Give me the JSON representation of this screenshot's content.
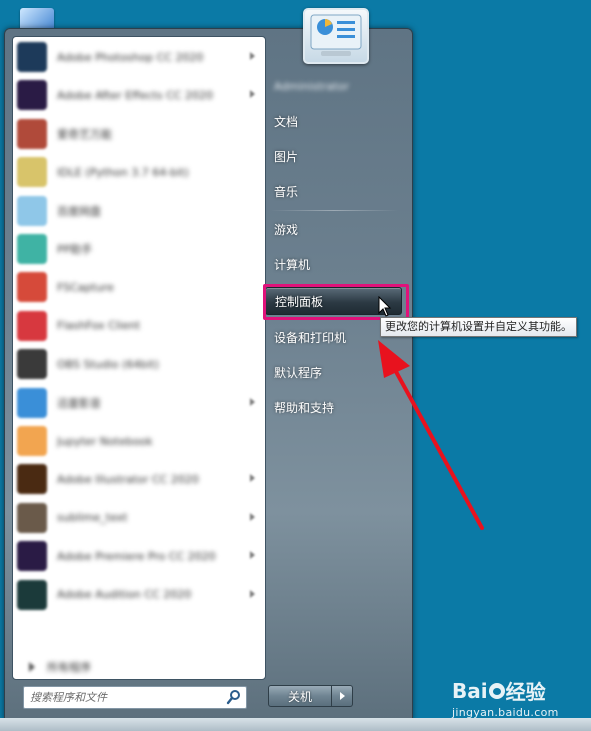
{
  "start_menu": {
    "programs": [
      {
        "label": "Adobe Photoshop CC 2020",
        "color": "#1d3a5a",
        "arrow": true
      },
      {
        "label": "Adobe After Effects CC 2020",
        "color": "#2a1b45",
        "arrow": true
      },
      {
        "label": "爱奇艺万能",
        "color": "#b04a3a",
        "arrow": false
      },
      {
        "label": "IDLE (Python 3.7 64-bit)",
        "color": "#d8c46a",
        "arrow": false
      },
      {
        "label": "百度网盘",
        "color": "#8fc7e8",
        "arrow": false
      },
      {
        "label": "PP助手",
        "color": "#3fb3a4",
        "arrow": false
      },
      {
        "label": "FSCapture",
        "color": "#d64a3a",
        "arrow": false
      },
      {
        "label": "FlashFox Client",
        "color": "#d7383f",
        "arrow": false
      },
      {
        "label": "OBS Studio (64bit)",
        "color": "#3a3a3a",
        "arrow": false
      },
      {
        "label": "迅雷影音",
        "color": "#3a8fd8",
        "arrow": true
      },
      {
        "label": "Jupyter Notebook",
        "color": "#f2a550",
        "arrow": false
      },
      {
        "label": "Adobe Illustrator CC 2020",
        "color": "#4a2a12",
        "arrow": true
      },
      {
        "label": "sublime_text",
        "color": "#6a5a4a",
        "arrow": true
      },
      {
        "label": "Adobe Premiere Pro CC 2020",
        "color": "#2a1b45",
        "arrow": true
      },
      {
        "label": "Adobe Audition CC 2020",
        "color": "#1b3a3a",
        "arrow": true
      }
    ],
    "all_programs_label": "所有程序",
    "search": {
      "placeholder": "搜索程序和文件"
    },
    "user_name": "Administrator",
    "links": {
      "documents": "文档",
      "pictures": "图片",
      "music": "音乐",
      "games": "游戏",
      "computer": "计算机",
      "control_panel": "控制面板",
      "devices_printers": "设备和打印机",
      "default_programs": "默认程序",
      "help_support": "帮助和支持"
    },
    "tooltip": "更改您的计算机设置并自定义其功能。",
    "shutdown_label": "关机"
  },
  "watermark": {
    "logo_left": "Bai",
    "logo_right": "经验",
    "url": "jingyan.baidu.com"
  },
  "colors": {
    "desktop": "#0b7aa6",
    "highlight_frame": "#e0127a",
    "annotation_arrow": "#e8121e"
  }
}
